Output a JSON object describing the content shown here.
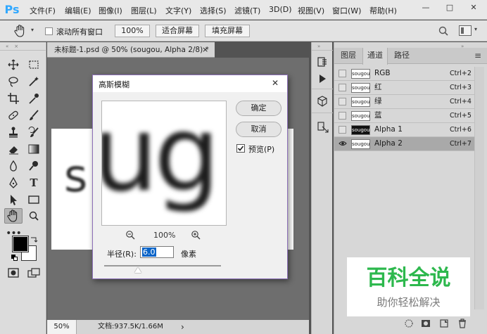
{
  "menubar": {
    "logo": "Ps",
    "items": [
      "文件(F)",
      "编辑(E)",
      "图像(I)",
      "图层(L)",
      "文字(Y)",
      "选择(S)",
      "滤镜(T)",
      "3D(D)",
      "视图(V)",
      "窗口(W)",
      "帮助(H)"
    ],
    "window_controls": {
      "minimize": "—",
      "maximize": "□",
      "close": "✕"
    }
  },
  "optionsbar": {
    "scroll_all_label": "滚动所有窗口",
    "zoom_value": "100%",
    "fit_screen": "适合屏幕",
    "fill_screen": "填充屏幕"
  },
  "document": {
    "tab_title": "未标题-1.psd @ 50% (sougou, Alpha 2/8) *",
    "tab_close": "×",
    "canvas_text": "s",
    "status_zoom": "50%",
    "status_doc": "文档:937.5K/1.66M",
    "status_arrow": "›"
  },
  "panel": {
    "tabs": [
      "图层",
      "通道",
      "路径"
    ],
    "menu_icon": "≡",
    "channels": [
      {
        "name": "RGB",
        "shortcut": "Ctrl+2",
        "thumb": "sougou",
        "visible": false,
        "dark": false,
        "selected": false
      },
      {
        "name": "红",
        "shortcut": "Ctrl+3",
        "thumb": "sougou",
        "visible": false,
        "dark": false,
        "selected": false
      },
      {
        "name": "绿",
        "shortcut": "Ctrl+4",
        "thumb": "sougou",
        "visible": false,
        "dark": false,
        "selected": false
      },
      {
        "name": "蓝",
        "shortcut": "Ctrl+5",
        "thumb": "sougou",
        "visible": false,
        "dark": false,
        "selected": false
      },
      {
        "name": "Alpha 1",
        "shortcut": "Ctrl+6",
        "thumb": "sougou",
        "visible": false,
        "dark": true,
        "selected": false
      },
      {
        "name": "Alpha 2",
        "shortcut": "Ctrl+7",
        "thumb": "sougou",
        "visible": true,
        "dark": false,
        "selected": true
      }
    ]
  },
  "dialog": {
    "title": "高斯模糊",
    "close": "✕",
    "ok": "确定",
    "cancel": "取消",
    "preview_label": "预览(P)",
    "preview_text": "ug",
    "zoom_percent": "100%",
    "radius_label": "半径(R):",
    "radius_value": "6.0",
    "unit": "像素",
    "slider_fraction": 0.29
  },
  "watermark": {
    "title": "百科全说",
    "subtitle": "助你轻松解决",
    "title_color": "#2db84d"
  },
  "colors": {
    "accent": "#31a8ff",
    "dialog_border": "#8c6fb8",
    "selection": "#0a64c8"
  }
}
